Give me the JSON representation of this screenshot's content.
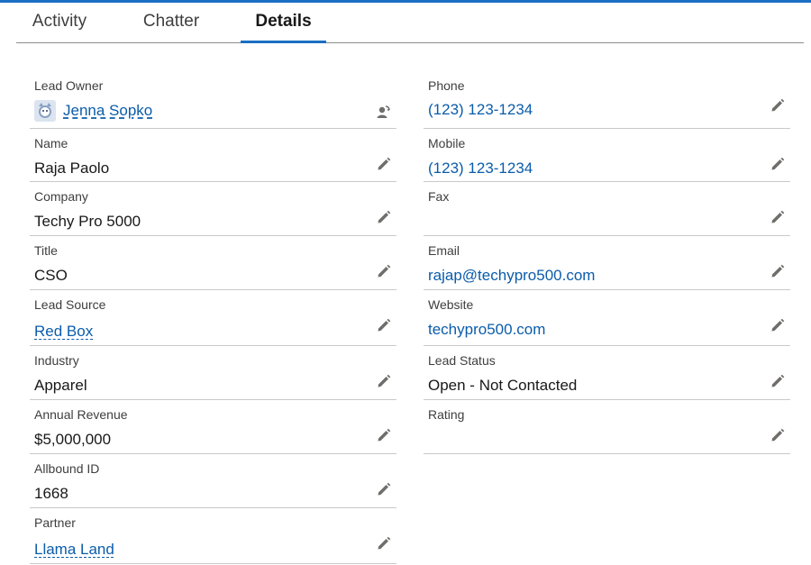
{
  "tabs": [
    {
      "label": "Activity",
      "active": false
    },
    {
      "label": "Chatter",
      "active": false
    },
    {
      "label": "Details",
      "active": true
    }
  ],
  "left_fields": [
    {
      "label": "Lead Owner",
      "value": "Jenna Sopko",
      "type": "owner",
      "icons": [
        "avatar-icon",
        "change-owner-icon"
      ]
    },
    {
      "label": "Name",
      "value": "Raja Paolo",
      "type": "text"
    },
    {
      "label": "Company",
      "value": "Techy Pro 5000",
      "type": "text"
    },
    {
      "label": "Title",
      "value": "CSO",
      "type": "text"
    },
    {
      "label": "Lead Source",
      "value": "Red Box",
      "type": "lookup"
    },
    {
      "label": "Industry",
      "value": "Apparel",
      "type": "text"
    },
    {
      "label": "Annual Revenue",
      "value": "$5,000,000",
      "type": "text"
    },
    {
      "label": "Allbound ID",
      "value": "1668",
      "type": "text"
    },
    {
      "label": "Partner",
      "value": "Llama Land",
      "type": "lookup"
    }
  ],
  "right_fields": [
    {
      "label": "Phone",
      "value": "(123) 123-1234",
      "type": "link"
    },
    {
      "label": "Mobile",
      "value": "(123) 123-1234",
      "type": "link"
    },
    {
      "label": "Fax",
      "value": "",
      "type": "text"
    },
    {
      "label": "Email",
      "value": "rajap@techypro500.com",
      "type": "link"
    },
    {
      "label": "Website",
      "value": "techypro500.com",
      "type": "link"
    },
    {
      "label": "Lead Status",
      "value": "Open - Not Contacted",
      "type": "text"
    },
    {
      "label": "Rating",
      "value": "",
      "type": "text"
    }
  ],
  "icons": {
    "edit": "pencil-icon"
  },
  "colors": {
    "accent": "#1b6ec2",
    "link": "#0b5cab",
    "icon": "#706e6b"
  }
}
